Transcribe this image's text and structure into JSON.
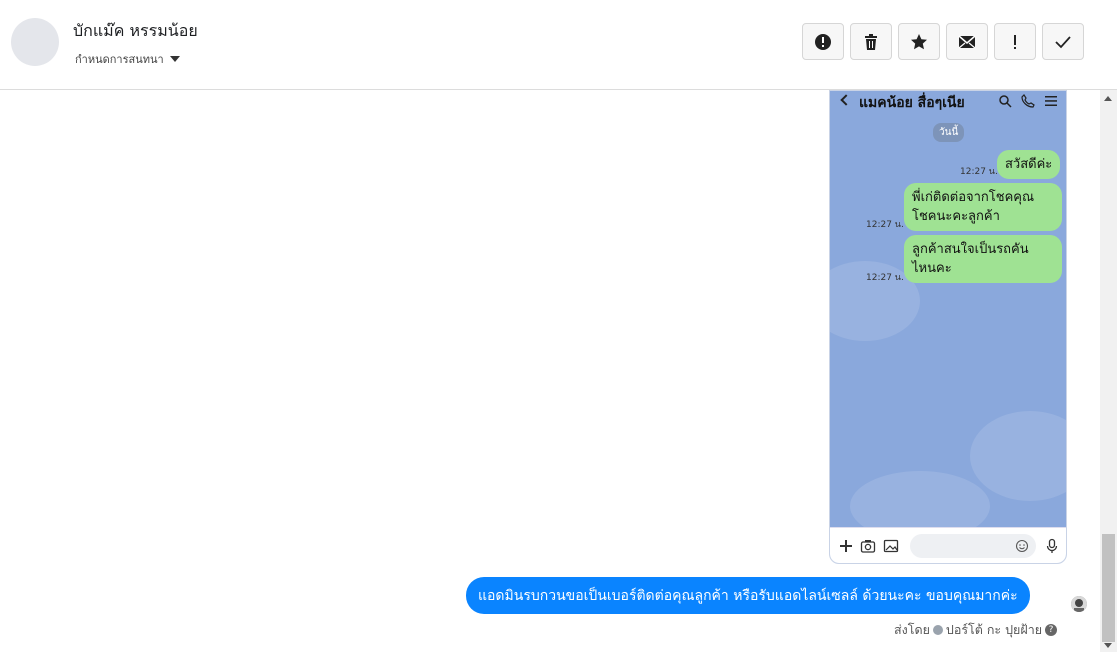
{
  "header": {
    "contact_name": "บักแม๊ค หรรมน้อย",
    "set_conversation_label": "กำหนดการสนทนา",
    "actions": {
      "spam": "exclamation-circle-icon",
      "delete": "trash-icon",
      "star": "star-icon",
      "mail": "envelope-icon",
      "important": "exclamation-icon",
      "done": "check-icon"
    }
  },
  "line_screenshot": {
    "title": "แมคน้อย สื่อๆเนีย",
    "date_label": "วันนี้",
    "messages": [
      {
        "text": "สวัสดีค่ะ",
        "time": "12:27 น."
      },
      {
        "text": "พี่เก่ติดต่อจากโชคคุณ\nโชคนะคะลูกค้า",
        "time": "12:27 น."
      },
      {
        "text": "ลูกค้าสนใจเป็นรถคัน\nไหนคะ",
        "time": "12:27 น."
      }
    ]
  },
  "outgoing_message": {
    "text": "แอดมินรบกวนขอเป็นเบอร์ติดต่อคุณลูกค้า หรือรับแอดไลน์เซลล์  ด้วยนะคะ ขอบคุณมากค่ะ"
  },
  "sent_by": {
    "prefix": "ส่งโดย",
    "name": "ปอร์โต้ กะ ปุยฝ้าย",
    "help_icon": "?"
  },
  "colors": {
    "brand_blue": "#0a84ff",
    "line_bg": "#8aa8dc",
    "line_bubble": "#9fe293"
  }
}
